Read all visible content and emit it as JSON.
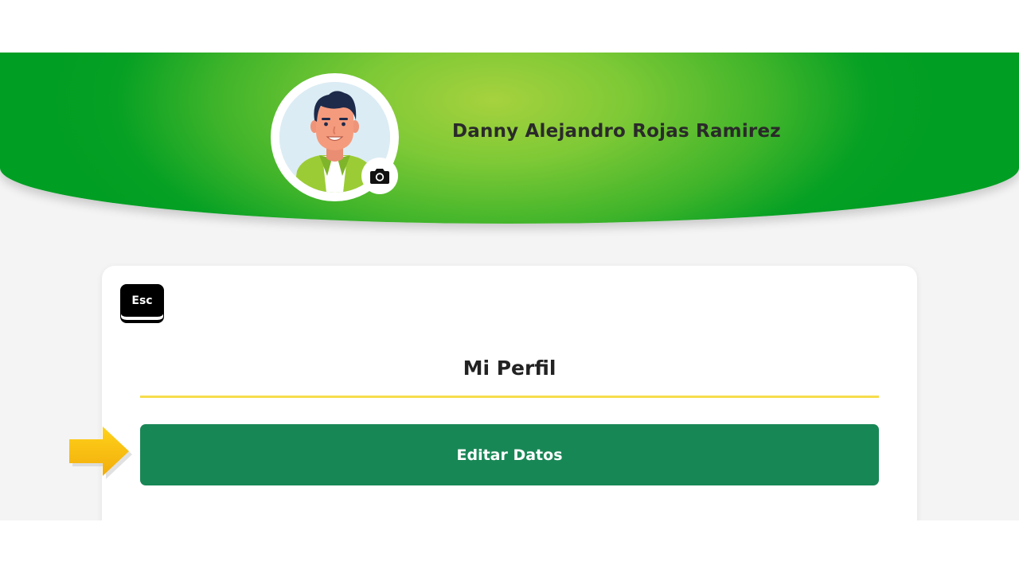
{
  "profile": {
    "user_name": "Danny Alejandro Rojas Ramirez"
  },
  "card": {
    "esc_label": "Esc",
    "title": "Mi Perfil",
    "edit_button_label": "Editar Datos"
  },
  "icons": {
    "camera": "camera-icon",
    "arrow": "arrow-right-icon"
  },
  "colors": {
    "banner_green": "#009e23",
    "banner_highlight": "#a6d23e",
    "primary_button": "#188756",
    "accent_rule": "#f6dc4c",
    "pointer_arrow": "#f6bf12",
    "page_background": "#f4f4f4"
  }
}
